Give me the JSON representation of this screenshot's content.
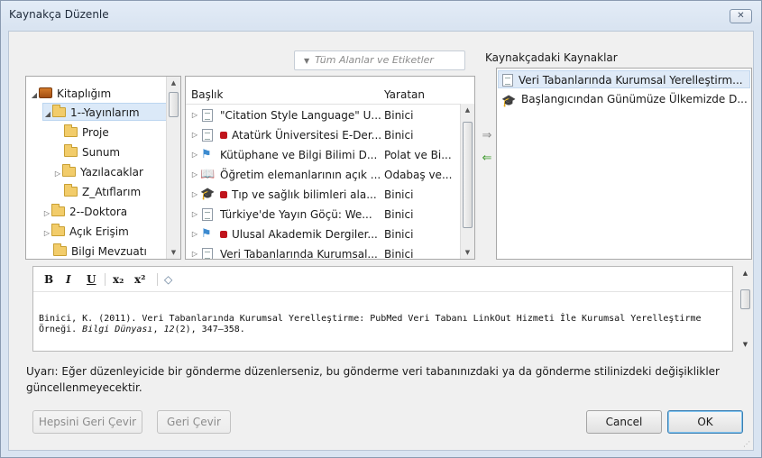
{
  "window": {
    "title": "Kaynakça Düzenle",
    "close_label": "✕"
  },
  "search": {
    "placeholder": "Tüm Alanlar ve Etiketler"
  },
  "collections": {
    "items": [
      {
        "label": "Kitaplığım",
        "toggle": "◢"
      },
      {
        "label": "1--Yayınlarım",
        "toggle": "◢"
      },
      {
        "label": "Proje",
        "toggle": ""
      },
      {
        "label": "Sunum",
        "toggle": ""
      },
      {
        "label": "Yazılacaklar",
        "toggle": "▷"
      },
      {
        "label": "Z_Atıflarım",
        "toggle": ""
      },
      {
        "label": "2--Doktora",
        "toggle": "▷"
      },
      {
        "label": "Açık Erişim",
        "toggle": "▷"
      },
      {
        "label": "Bilgi Mevzuatı",
        "toggle": ""
      }
    ]
  },
  "items": {
    "columns": {
      "title": "Başlık",
      "creator": "Yaratan"
    },
    "rows": [
      {
        "title": "\"Citation Style Language\" U...",
        "creator": "Binici",
        "type": "doc",
        "tag": false
      },
      {
        "title": "Atatürk Üniversitesi E-Der...",
        "creator": "Binici",
        "type": "doc",
        "tag": true
      },
      {
        "title": "Kütüphane ve Bilgi Bilimi D...",
        "creator": "Polat ve Bi...",
        "type": "pers",
        "tag": false
      },
      {
        "title": "Öğretim elemanlarının açık ...",
        "creator": "Odabaş ve...",
        "type": "book",
        "tag": false
      },
      {
        "title": "Tıp ve sağlık bilimleri ala...",
        "creator": "Binici",
        "type": "cap",
        "tag": true
      },
      {
        "title": "Türkiye'de Yayın Göçü: We...",
        "creator": "Binici",
        "type": "doc",
        "tag": false
      },
      {
        "title": "Ulusal Akademik Dergiler...",
        "creator": "Binici",
        "type": "pers",
        "tag": true
      },
      {
        "title": "Veri Tabanlarında Kurumsal...",
        "creator": "Binici",
        "type": "doc",
        "tag": false
      }
    ]
  },
  "move": {
    "add": "⇒",
    "remove": "⇐"
  },
  "cited": {
    "label": "Kaynakçadaki Kaynaklar",
    "items": [
      {
        "title": "Veri Tabanlarında Kurumsal Yerelleştirm...",
        "type": "doc"
      },
      {
        "title": "Başlangıcından Günümüze Ülkemizde D...",
        "type": "cap"
      }
    ]
  },
  "editor": {
    "toolbar": {
      "bold": "B",
      "italic": "I",
      "underline": "U",
      "subscript": "x",
      "subscript_mark": "₂",
      "superscript": "x",
      "superscript_mark": "²",
      "clear": "◇"
    },
    "citation": {
      "part1": "Binici, K. (2011). Veri Tabanlarında Kurumsal Yerelleştirme: PubMed Veri Tabanı LinkOut Hizmeti İle Kurumsal Yerelleştirme Örneği. ",
      "journal": "Bilgi Dünyası",
      "sep": ", ",
      "volume": "12",
      "part2": "(2), 347–358."
    }
  },
  "warning": "Uyarı: Eğer düzenleyicide bir gönderme düzenlerseniz, bu gönderme veri tabanınızdaki ya da gönderme stilinizdeki değişiklikler güncellenmeyecektir.",
  "buttons": {
    "revert_all": "Hepsini Geri Çevir",
    "revert": "Geri Çevir",
    "cancel": "Cancel",
    "ok": "OK"
  }
}
